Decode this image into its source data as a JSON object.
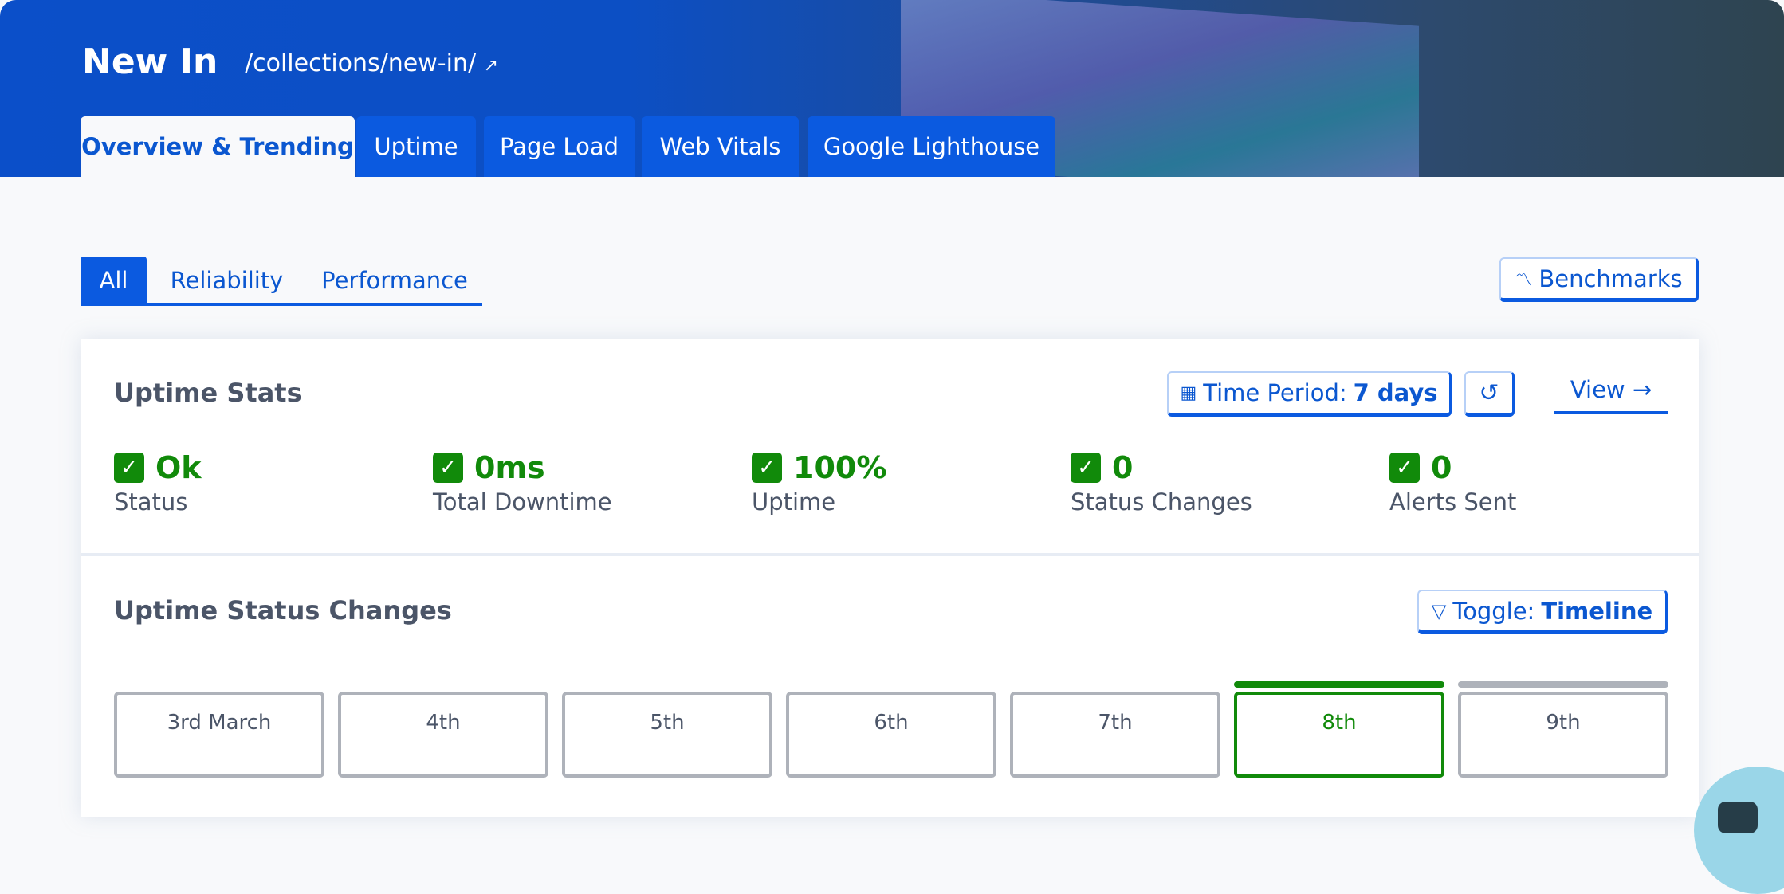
{
  "header": {
    "title": "New In",
    "path": "/collections/new-in/",
    "tabs": [
      "Overview & Trending",
      "Uptime",
      "Page Load",
      "Web Vitals",
      "Google Lighthouse"
    ],
    "active_tab": 0
  },
  "subtabs": {
    "items": [
      "All",
      "Reliability",
      "Performance"
    ],
    "active": 0
  },
  "benchmarks_label": "Benchmarks",
  "uptime_stats": {
    "title": "Uptime Stats",
    "time_period_label": "Time Period:",
    "time_period_value": "7 days",
    "view_label": "View →",
    "stats": [
      {
        "value": "Ok",
        "label": "Status"
      },
      {
        "value": "0ms",
        "label": "Total Downtime"
      },
      {
        "value": "100%",
        "label": "Uptime"
      },
      {
        "value": "0",
        "label": "Status Changes"
      },
      {
        "value": "0",
        "label": "Alerts Sent"
      }
    ]
  },
  "status_changes": {
    "title": "Uptime Status Changes",
    "toggle_label": "Toggle:",
    "toggle_value": "Timeline",
    "days": [
      {
        "label": "3rd March",
        "state": "none"
      },
      {
        "label": "4th",
        "state": "none"
      },
      {
        "label": "5th",
        "state": "none"
      },
      {
        "label": "6th",
        "state": "none"
      },
      {
        "label": "7th",
        "state": "none"
      },
      {
        "label": "8th",
        "state": "up"
      },
      {
        "label": "9th",
        "state": "pending"
      }
    ]
  },
  "colors": {
    "accent": "#0b5ae0",
    "success": "#118a0a",
    "neutral": "#aeb2ba"
  }
}
